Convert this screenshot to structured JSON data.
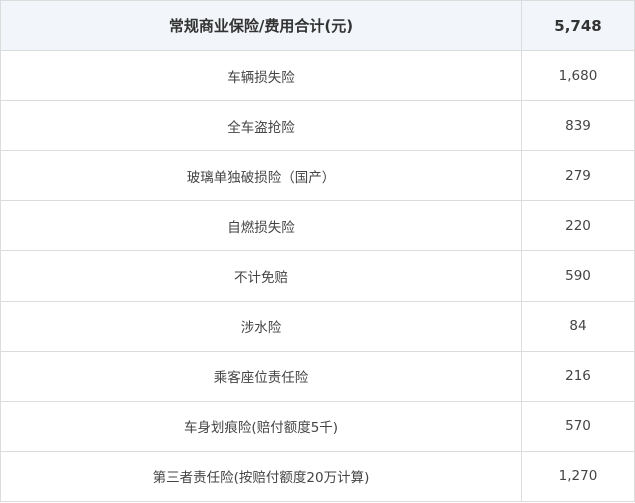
{
  "header": {
    "label": "常规商业保险/费用合计(元)",
    "total": "5,748"
  },
  "rows": [
    {
      "item": "车辆损失险",
      "cost": "1,680"
    },
    {
      "item": "全车盗抢险",
      "cost": "839"
    },
    {
      "item": "玻璃单独破损险（国产）",
      "cost": "279"
    },
    {
      "item": "自燃损失险",
      "cost": "220"
    },
    {
      "item": "不计免赔",
      "cost": "590"
    },
    {
      "item": "涉水险",
      "cost": "84"
    },
    {
      "item": "乘客座位责任险",
      "cost": "216"
    },
    {
      "item": "车身划痕险(赔付额度5千)",
      "cost": "570"
    },
    {
      "item": "第三者责任险(按赔付额度20万计算)",
      "cost": "1,270"
    }
  ],
  "colors": {
    "header_bg": "#f2f6fa",
    "border": "#dcdcdc",
    "text": "#333333"
  }
}
